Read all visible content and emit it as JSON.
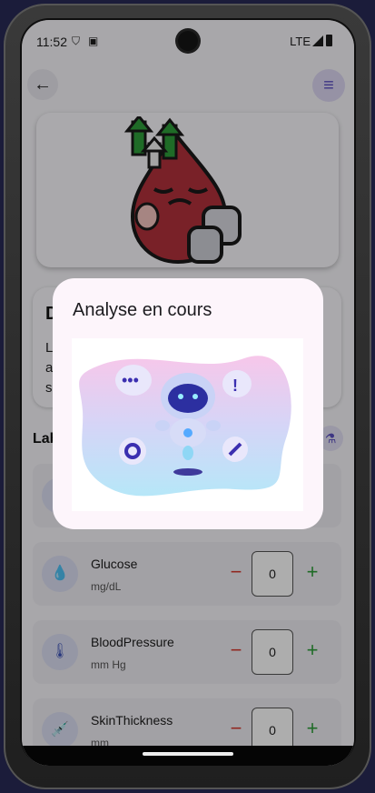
{
  "status_bar": {
    "time": "11:52",
    "network": "LTE"
  },
  "top_bar": {
    "back_icon": "arrow-back",
    "menu_icon": "menu-lines"
  },
  "description_card": {
    "title": "D",
    "body": "L\na                                                               e\ns"
  },
  "lab_section": {
    "title": "Lab",
    "icon": "flask-icon"
  },
  "lab_items": [
    {
      "name": "",
      "unit": "",
      "value": "",
      "icon": "drop-icon"
    },
    {
      "name": "Glucose",
      "unit": "mg/dL",
      "value": "0",
      "icon": "glucose-drop-icon"
    },
    {
      "name": "BloodPressure",
      "unit": "mm Hg",
      "value": "0",
      "icon": "thermometer-icon"
    },
    {
      "name": "SkinThickness",
      "unit": "mm",
      "value": "0",
      "icon": "syringe-icon"
    }
  ],
  "controls": {
    "decrement": "−",
    "increment": "+"
  },
  "dialog": {
    "title": "Analyse en cours"
  },
  "colors": {
    "accent": "#5a4fc2",
    "minus": "#d6392f",
    "plus": "#2f9e3a",
    "dialog_bg": "#fdf5fb"
  }
}
